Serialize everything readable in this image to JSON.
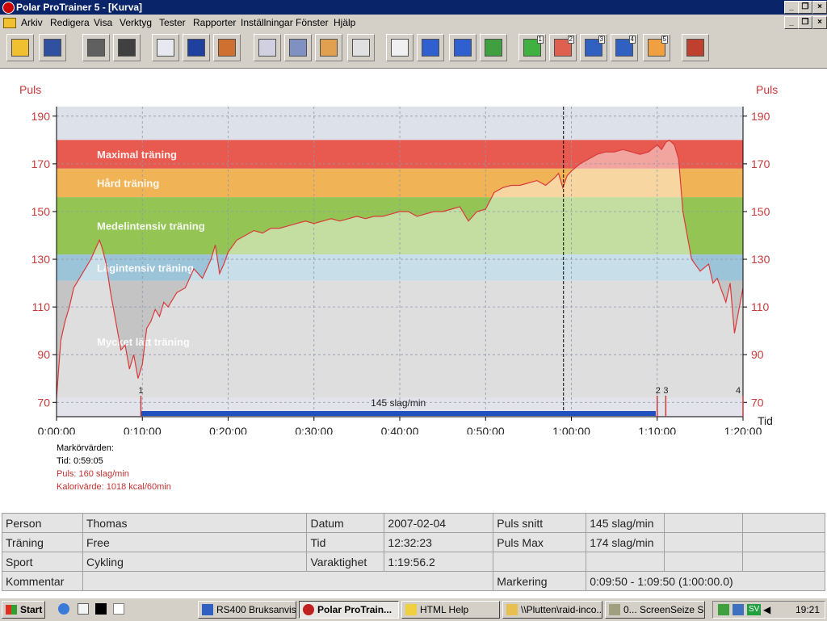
{
  "window": {
    "title": "Polar ProTrainer 5 - [Kurva]"
  },
  "menu": [
    "Arkiv",
    "Redigera",
    "Visa",
    "Verktyg",
    "Tester",
    "Rapporter",
    "Inställningar",
    "Fönster",
    "Hjälp"
  ],
  "toolbar": {
    "buttons": [
      {
        "name": "open-icon"
      },
      {
        "name": "save-icon"
      },
      {
        "name": "sync-icon"
      },
      {
        "name": "settings-icon"
      },
      {
        "name": "calendar-icon"
      },
      {
        "name": "book-icon"
      },
      {
        "name": "user-feedback-icon"
      },
      {
        "name": "curve-view-icon"
      },
      {
        "name": "bar-view-icon"
      },
      {
        "name": "zone-percent-icon"
      },
      {
        "name": "table-view-icon"
      },
      {
        "name": "zoom-1-1-icon"
      },
      {
        "name": "info-chart-icon"
      },
      {
        "name": "info-marker-icon"
      },
      {
        "name": "multi-curve-icon"
      },
      {
        "name": "chart-1-icon",
        "num": "1"
      },
      {
        "name": "chart-2-icon",
        "num": "2"
      },
      {
        "name": "chart-3-icon",
        "num": "3"
      },
      {
        "name": "chart-4-icon",
        "num": "4"
      },
      {
        "name": "chart-5-icon",
        "num": "5"
      },
      {
        "name": "users-icon"
      }
    ]
  },
  "colors": {
    "maximal": "#e85a50",
    "hard": "#f0b456",
    "medium": "#94c454",
    "light": "#9cc4d8",
    "very_light": "#c4c4c4",
    "curve": "#d83a3a",
    "marker_bar": "#2050c0"
  },
  "chart_data": {
    "type": "line",
    "ylabel_left": "Puls",
    "ylabel_right": "Puls",
    "xlabel": "Tid",
    "ylim": [
      64,
      194
    ],
    "xlim_minutes": [
      0,
      80
    ],
    "y_ticks": [
      70,
      90,
      110,
      130,
      150,
      170,
      190
    ],
    "x_ticks": [
      "0:00:00",
      "0:10:00",
      "0:20:00",
      "0:30:00",
      "0:40:00",
      "0:50:00",
      "1:00:00",
      "1:10:00",
      "1:20:00"
    ],
    "zones": [
      {
        "label": "Maximal träning",
        "from": 168,
        "to": 180,
        "color": "maximal"
      },
      {
        "label": "Hård träning",
        "from": 156,
        "to": 168,
        "color": "hard"
      },
      {
        "label": "Medelintensiv träning",
        "from": 132,
        "to": 156,
        "color": "medium"
      },
      {
        "label": "Lågintensiv träning",
        "from": 121,
        "to": 132,
        "color": "light"
      },
      {
        "label": "Mycket lätt träning",
        "from": 70,
        "to": 121,
        "color": "very_light"
      }
    ],
    "series": [
      {
        "x_minutes": [
          0,
          0.5,
          1,
          1.5,
          2,
          3,
          4,
          5,
          5.3,
          5.8,
          6.3,
          7,
          7.5,
          8,
          8.5,
          9,
          9.5,
          10,
          10.5,
          11,
          11.5,
          12,
          12.5,
          13,
          14,
          15,
          16,
          17,
          18,
          18.5,
          19,
          19.5,
          20,
          21,
          22,
          23,
          24,
          25,
          26,
          27,
          28,
          29,
          30,
          31,
          32,
          33,
          34,
          35,
          36,
          37,
          38,
          39,
          40,
          41,
          42,
          43,
          44,
          45,
          46,
          47,
          48,
          49,
          50,
          51,
          52,
          53,
          54,
          55,
          56,
          57,
          58,
          58.5,
          59,
          59.5,
          60,
          61,
          62,
          63,
          64,
          65,
          66,
          67,
          68,
          69,
          70,
          70.5,
          71,
          71.4,
          72,
          72.5,
          73,
          74,
          75,
          76,
          76.5,
          77,
          77.5,
          78,
          78.5,
          79,
          80
        ],
        "y": [
          72,
          96,
          104,
          110,
          118,
          124,
          130,
          138,
          135,
          128,
          116,
          102,
          92,
          94,
          84,
          90,
          80,
          86,
          101,
          104,
          109,
          106,
          112,
          110,
          116,
          118,
          126,
          122,
          130,
          136,
          124,
          128,
          133,
          138,
          140,
          142,
          141,
          143,
          143,
          144,
          145,
          146,
          145,
          146,
          147,
          146,
          147,
          148,
          147,
          148,
          148,
          149,
          150,
          150,
          148,
          149,
          150,
          150,
          151,
          152,
          146,
          150,
          151,
          158,
          160,
          161,
          161,
          162,
          163,
          161,
          164,
          166,
          160,
          165,
          167,
          170,
          172,
          174,
          175,
          175,
          176,
          175,
          174,
          175,
          178,
          176,
          179,
          180,
          178,
          172,
          150,
          130,
          125,
          128,
          120,
          122,
          117,
          112,
          120,
          99,
          118,
          120,
          120
        ]
      }
    ],
    "marker_line_minutes": 59.08,
    "marker_bar": {
      "from_minutes": 9.83,
      "to_minutes": 69.83,
      "label": "145 slag/min"
    },
    "markers": [
      {
        "label": "1",
        "x_minutes": 9.83
      },
      {
        "label": "2",
        "x_minutes": 70.0
      },
      {
        "label": "3",
        "x_minutes": 71.0
      },
      {
        "label": "4",
        "x_minutes": 80.0
      }
    ]
  },
  "marker_values": {
    "title": "Markörvärden:",
    "time": "Tid: 0:59:05",
    "pulse": "Puls: 160 slag/min",
    "calories": "Kalorivärde: 1018 kcal/60min"
  },
  "info": {
    "rows": [
      [
        "Person",
        "Thomas",
        "Datum",
        "2007-02-04",
        "Puls snitt",
        "145 slag/min",
        "",
        ""
      ],
      [
        "Träning",
        "Free",
        "Tid",
        "12:32:23",
        "Puls Max",
        "174 slag/min",
        "",
        ""
      ],
      [
        "Sport",
        "Cykling",
        "Varaktighet",
        "1:19:56.2",
        "",
        "",
        "",
        ""
      ]
    ],
    "comment_label": "Kommentar",
    "comment_value": "",
    "marking_label": "Markering",
    "marking_value": "0:09:50 - 1:09:50 (1:00:00.0)"
  },
  "taskbar": {
    "start": "Start",
    "tasks": [
      {
        "label": "RS400 Bruksanvis...",
        "active": false
      },
      {
        "label": "Polar ProTrain...",
        "active": true
      },
      {
        "label": "HTML Help",
        "active": false
      },
      {
        "label": "\\\\Plutten\\raid-inco...",
        "active": false
      },
      {
        "label": "0... ScreenSeize S...",
        "active": false
      }
    ],
    "lang": "SV",
    "clock": "19:21"
  }
}
